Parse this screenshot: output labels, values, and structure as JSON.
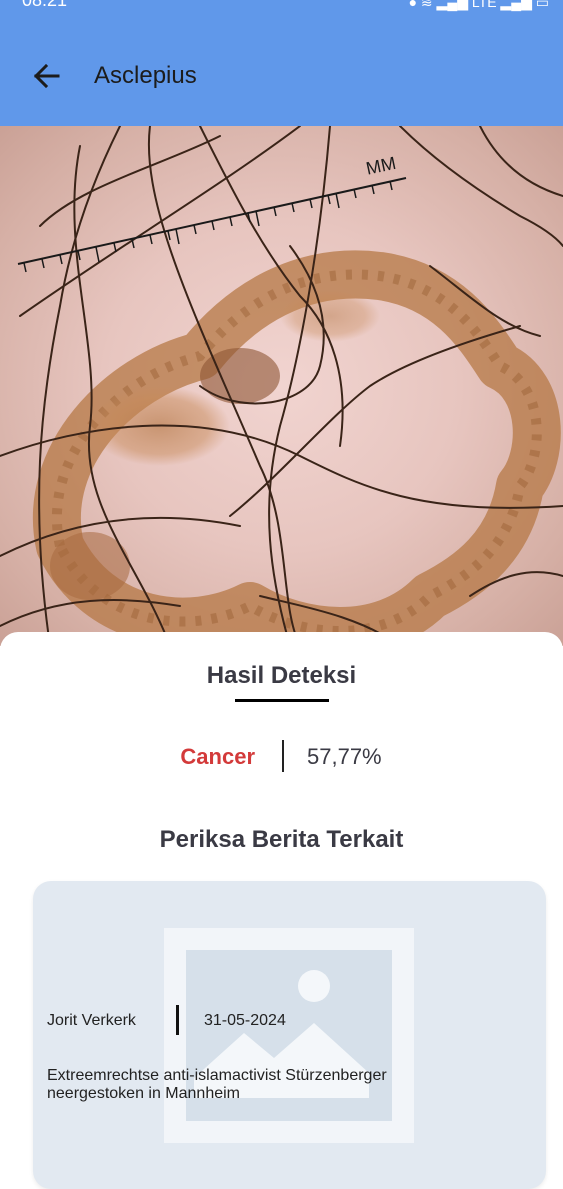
{
  "status_bar": {
    "time": "08.21",
    "network": "LTE"
  },
  "appbar": {
    "title": "Asclepius",
    "back_icon": "arrow-left-icon"
  },
  "image": {
    "ruler_label": "MM"
  },
  "result": {
    "title": "Hasil Deteksi",
    "label": "Cancer",
    "confidence": "57,77%",
    "label_color": "#d33a3a"
  },
  "related": {
    "title": "Periksa Berita Terkait",
    "articles": [
      {
        "author": "Jorit Verkerk",
        "date": "31-05-2024",
        "headline": "Extreemrechtse anti-islamactivist Stürzenberger neergestoken in Mannheim",
        "thumbnail_icon": "image-placeholder-icon"
      }
    ]
  },
  "colors": {
    "appbar": "#6098ea",
    "card": "#e2e9f1"
  }
}
